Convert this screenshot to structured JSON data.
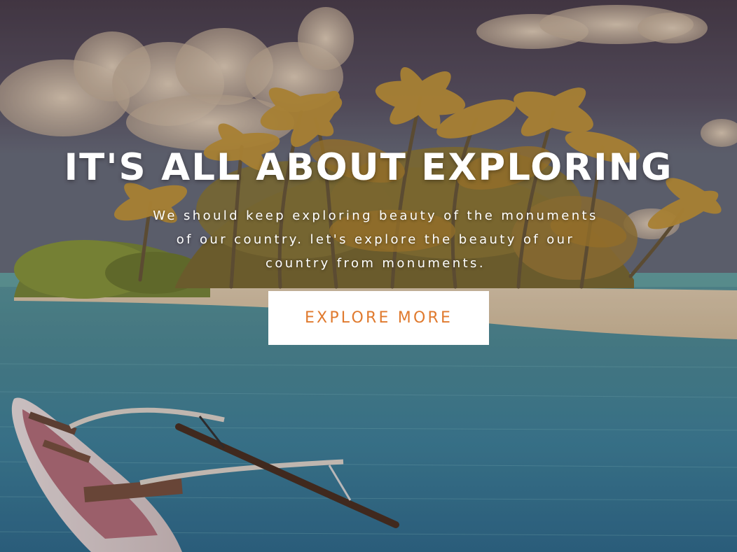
{
  "hero": {
    "title": "IT'S ALL ABOUT EXPLORING",
    "subtitle": "We should keep exploring beauty of the monuments of our country. let's explore the beauty of our country from monuments.",
    "button_label": "EXPLORE MORE",
    "accent_color": "#e07a2e",
    "background_image": "tropical-island-beach-with-outrigger-canoe"
  }
}
